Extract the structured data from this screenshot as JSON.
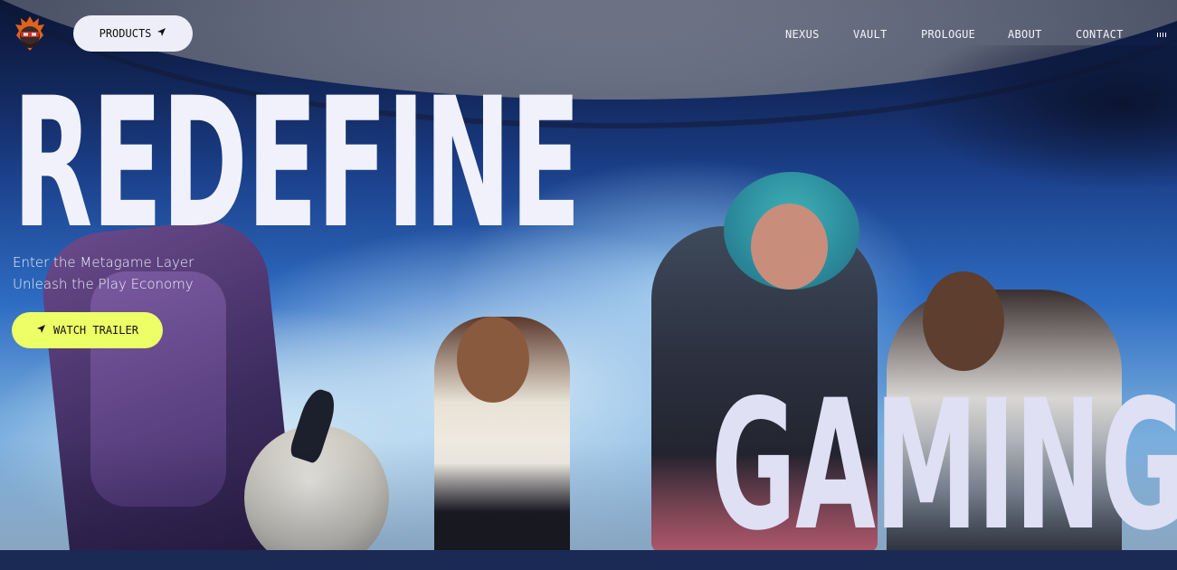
{
  "header": {
    "logo": {
      "icon": "ninja-logo-icon"
    },
    "products_button": {
      "label": "PRODUCTS",
      "icon": "arrow-icon"
    },
    "nav_links": [
      "NEXUS",
      "VAULT",
      "PROLOGUE",
      "ABOUT",
      "CONTACT"
    ],
    "audio_indicator": {
      "icon": "audio-bars-icon"
    }
  },
  "hero": {
    "headline_top": "REDEFINE",
    "headline_bottom": "GAMING",
    "subtitle_line1": "Enter the Metagame Layer",
    "subtitle_line2": "Unleash the Play Economy",
    "cta_button": {
      "label": "WATCH TRAILER",
      "icon": "arrow-icon"
    }
  },
  "colors": {
    "headline": "#f0f1fb",
    "products_button_bg": "#eeeef9",
    "cta_button_bg": "#edff66",
    "text_light": "#f3f3fb"
  }
}
